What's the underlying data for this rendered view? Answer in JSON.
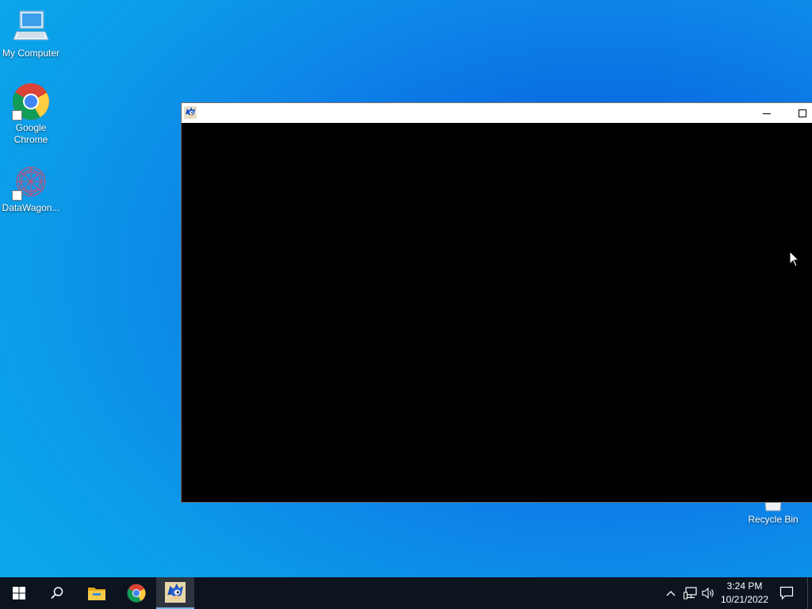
{
  "desktop": {
    "icons": [
      {
        "label": "My Computer",
        "icon": "computer-icon",
        "shortcut": false
      },
      {
        "label": "Google Chrome",
        "icon": "chrome-icon",
        "shortcut": true
      },
      {
        "label": "DataWagon...",
        "icon": "datawagon-icon",
        "shortcut": true
      },
      {
        "label": "Recycle Bin",
        "icon": "recycle-bin-icon",
        "shortcut": false
      }
    ],
    "background_color": "#0a6be0"
  },
  "window": {
    "title": "",
    "app_icon": "sonic-icon",
    "client_color": "#000000",
    "controls": [
      "minimize-icon",
      "maximize-icon"
    ]
  },
  "taskbar": {
    "pinned": [
      "windows-start-icon",
      "search-icon",
      "file-explorer-icon",
      "chrome-icon",
      "sonic-icon"
    ],
    "active": "sonic-icon",
    "tray": [
      "chevron-up-icon",
      "network-icon",
      "volume-icon"
    ],
    "clock": {
      "time": "3:24 PM",
      "date": "10/21/2022"
    },
    "notifications_icon": "action-center-icon"
  }
}
